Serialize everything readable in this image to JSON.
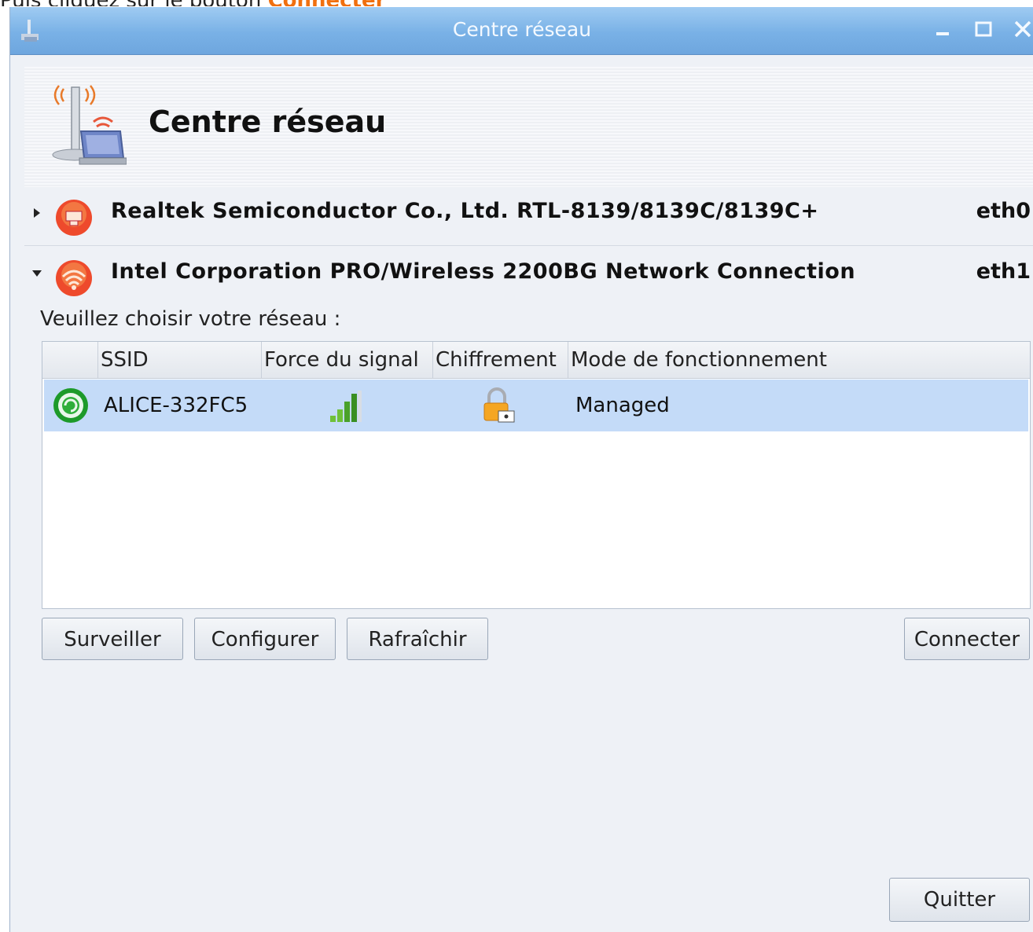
{
  "caption": {
    "prefix": "Puis cliquez sur le bouton ",
    "highlight": "Connecter"
  },
  "window": {
    "title": "Centre réseau"
  },
  "header": {
    "title": "Centre réseau"
  },
  "interfaces": [
    {
      "name": "Realtek Semiconductor Co., Ltd. RTL-8139/8139C/8139C+",
      "device": "eth0",
      "expanded": false
    },
    {
      "name": "Intel Corporation PRO/Wireless 2200BG Network Connection",
      "device": "eth1",
      "expanded": true
    }
  ],
  "networks": {
    "prompt": "Veuillez choisir votre réseau :",
    "columns": [
      "SSID",
      "Force du signal",
      "Chiffrement",
      "Mode de fonctionnement"
    ],
    "rows": [
      {
        "ssid": "ALICE-332FC5",
        "signal_bars": 4,
        "encrypted": true,
        "mode": "Managed"
      }
    ]
  },
  "buttons": {
    "monitor": "Surveiller",
    "configure": "Configurer",
    "refresh": "Rafraîchir",
    "connect": "Connecter",
    "quit": "Quitter"
  },
  "colors": {
    "titlebar": "#79b1e6",
    "selected_row": "#c4dbf8",
    "accent": "#f07010"
  },
  "icons": {
    "app": "network-center-icon",
    "eth0": "ethernet-icon",
    "eth1": "wireless-icon",
    "network": "wifi-network-icon",
    "signal": "signal-strength-icon",
    "lock": "lock-icon"
  }
}
